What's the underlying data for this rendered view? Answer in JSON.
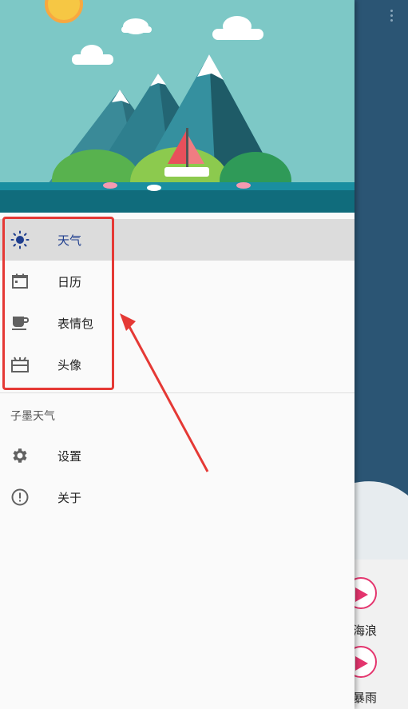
{
  "drawer": {
    "primary_items": [
      {
        "label": "天气",
        "icon": "sun-icon",
        "selected": true
      },
      {
        "label": "日历",
        "icon": "calendar-icon",
        "selected": false
      },
      {
        "label": "表情包",
        "icon": "cup-icon",
        "selected": false
      },
      {
        "label": "头像",
        "icon": "gift-box-icon",
        "selected": false
      }
    ],
    "section_title": "子墨天气",
    "secondary_items": [
      {
        "label": "设置",
        "icon": "gear-icon"
      },
      {
        "label": "关于",
        "icon": "info-icon"
      }
    ]
  },
  "background": {
    "items": [
      {
        "label": "海浪"
      },
      {
        "label": "暴雨"
      }
    ]
  },
  "colors": {
    "selected_text": "#1f3e8e",
    "highlight": "#e53935",
    "accent": "#e4356e"
  }
}
